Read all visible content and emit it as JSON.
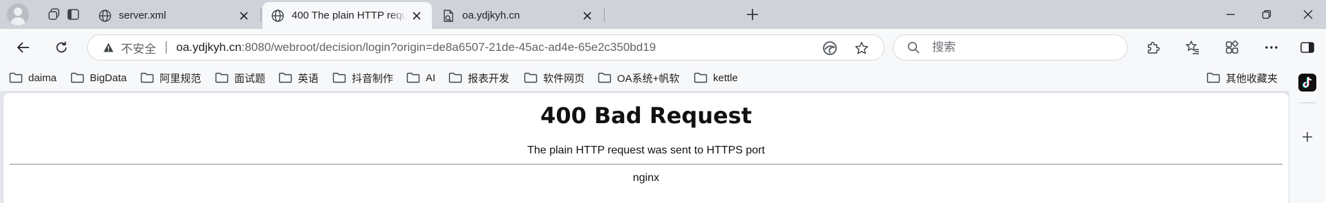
{
  "tabs": [
    {
      "title": "server.xml",
      "favicon": "globe-icon",
      "active": false
    },
    {
      "title": "400 The plain HTTP request was sent to HTTPS port",
      "favicon": "globe-icon",
      "active": true
    },
    {
      "title": "oa.ydjkyh.cn",
      "favicon": "broken-page-icon",
      "active": false
    }
  ],
  "toolbar": {
    "security_label": "不安全",
    "url_host": "oa.ydjkyh.cn",
    "url_rest": ":8080/webroot/decision/login?origin=de8a6507-21de-45ac-ad4e-65e2c350bd19",
    "search_placeholder": "搜索"
  },
  "bookmarks": [
    {
      "label": "daima"
    },
    {
      "label": "BigData"
    },
    {
      "label": "阿里规范"
    },
    {
      "label": "面试题"
    },
    {
      "label": "英语"
    },
    {
      "label": "抖音制作"
    },
    {
      "label": "AI"
    },
    {
      "label": "报表开发"
    },
    {
      "label": "软件网页"
    },
    {
      "label": "OA系统+帆软"
    },
    {
      "label": "kettle"
    }
  ],
  "other_bookmarks": {
    "label": "其他收藏夹"
  },
  "page": {
    "heading": "400 Bad Request",
    "message": "The plain HTTP request was sent to HTTPS port",
    "server": "nginx"
  },
  "colors": {
    "tabstrip": "#cfd3d9",
    "toolbar": "#f7f8fa",
    "icon": "#3c4043"
  }
}
